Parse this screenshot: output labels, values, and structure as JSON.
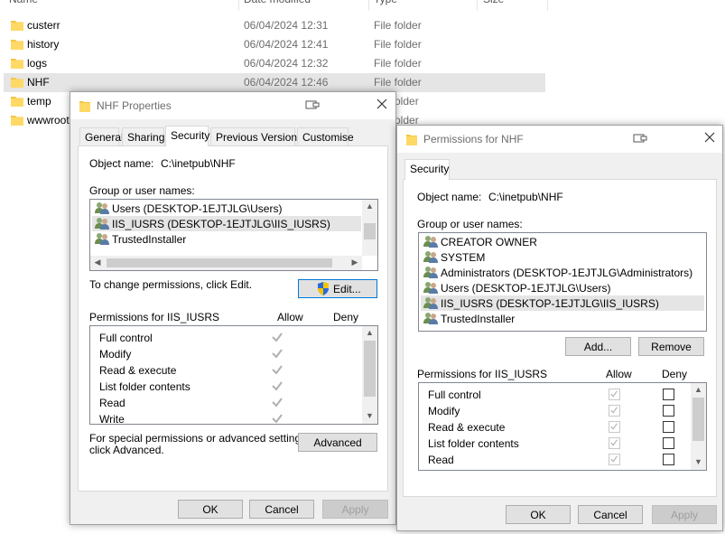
{
  "explorer": {
    "columns": {
      "name": "Name",
      "date_modified": "Date modified",
      "type": "Type",
      "size": "Size"
    },
    "rows": [
      {
        "name": "custerr",
        "date": "06/04/2024 12:31",
        "type": "File folder"
      },
      {
        "name": "history",
        "date": "06/04/2024 12:41",
        "type": "File folder"
      },
      {
        "name": "logs",
        "date": "06/04/2024 12:32",
        "type": "File folder"
      },
      {
        "name": "NHF",
        "date": "06/04/2024 12:46",
        "type": "File folder"
      },
      {
        "name": "temp",
        "date": "",
        "type": "older"
      },
      {
        "name": "wwwroot",
        "date": "",
        "type": "older"
      }
    ],
    "folder_color": "#f4c542"
  },
  "properties": {
    "title": "NHF Properties",
    "tabs": [
      "General",
      "Sharing",
      "Security",
      "Previous Versions",
      "Customise"
    ],
    "object_name_label": "Object name:",
    "object_name_value": "C:\\inetpub\\NHF",
    "group_label": "Group or user names:",
    "users": [
      "Users (DESKTOP-1EJTJLG\\Users)",
      "IIS_IUSRS (DESKTOP-1EJTJLG\\IIS_IUSRS)",
      "TrustedInstaller"
    ],
    "change_text": "To change permissions, click Edit.",
    "edit_button": "Edit...",
    "perms_for": "Permissions for IIS_IUSRS",
    "allow": "Allow",
    "deny": "Deny",
    "perms": [
      "Full control",
      "Modify",
      "Read & execute",
      "List folder contents",
      "Read",
      "Write"
    ],
    "special_text_1": "For special permissions or advanced settings,",
    "special_text_2": "click Advanced.",
    "advanced_button": "Advanced",
    "ok": "OK",
    "cancel": "Cancel",
    "apply": "Apply"
  },
  "permissions": {
    "title": "Permissions for NHF",
    "tab": "Security",
    "object_name_label": "Object name:",
    "object_name_value": "C:\\inetpub\\NHF",
    "group_label": "Group or user names:",
    "users": [
      "CREATOR OWNER",
      "SYSTEM",
      "Administrators (DESKTOP-1EJTJLG\\Administrators)",
      "Users (DESKTOP-1EJTJLG\\Users)",
      "IIS_IUSRS (DESKTOP-1EJTJLG\\IIS_IUSRS)",
      "TrustedInstaller"
    ],
    "add_button": "Add...",
    "remove_button": "Remove",
    "perms_for": "Permissions for IIS_IUSRS",
    "allow": "Allow",
    "deny": "Deny",
    "perms": [
      "Full control",
      "Modify",
      "Read & execute",
      "List folder contents",
      "Read"
    ],
    "ok": "OK",
    "cancel": "Cancel",
    "apply": "Apply"
  }
}
